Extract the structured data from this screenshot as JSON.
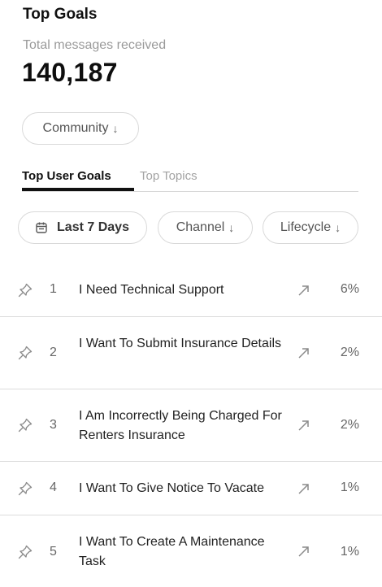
{
  "header": {
    "title": "Top Goals",
    "subtitle": "Total messages received",
    "total": "140,187"
  },
  "filters": {
    "community": "Community",
    "date": "Last 7 Days",
    "channel": "Channel",
    "lifecycle": "Lifecycle",
    "arrow": "↓"
  },
  "tabs": [
    {
      "label": "Top User Goals",
      "active": true
    },
    {
      "label": "Top Topics",
      "active": false
    }
  ],
  "goals": [
    {
      "rank": "1",
      "text": "I Need Technical Support",
      "pct": "6%"
    },
    {
      "rank": "2",
      "text": "I Want To Submit Insurance Details",
      "pct": "2%"
    },
    {
      "rank": "3",
      "text": "I Am Incorrectly Being Charged For Renters Insurance",
      "pct": "2%"
    },
    {
      "rank": "4",
      "text": "I Want To Give Notice To Vacate",
      "pct": "1%"
    },
    {
      "rank": "5",
      "text": "I Want To Create A Maintenance Task",
      "pct": "1%"
    }
  ],
  "icons": {
    "pin": "pin-icon",
    "trend": "trend-up-icon",
    "calendar": "calendar-icon"
  },
  "colors": {
    "text": "#222222",
    "muted": "#9a9a9a",
    "border": "#d9d9d9",
    "icon": "#8a8a8a"
  }
}
